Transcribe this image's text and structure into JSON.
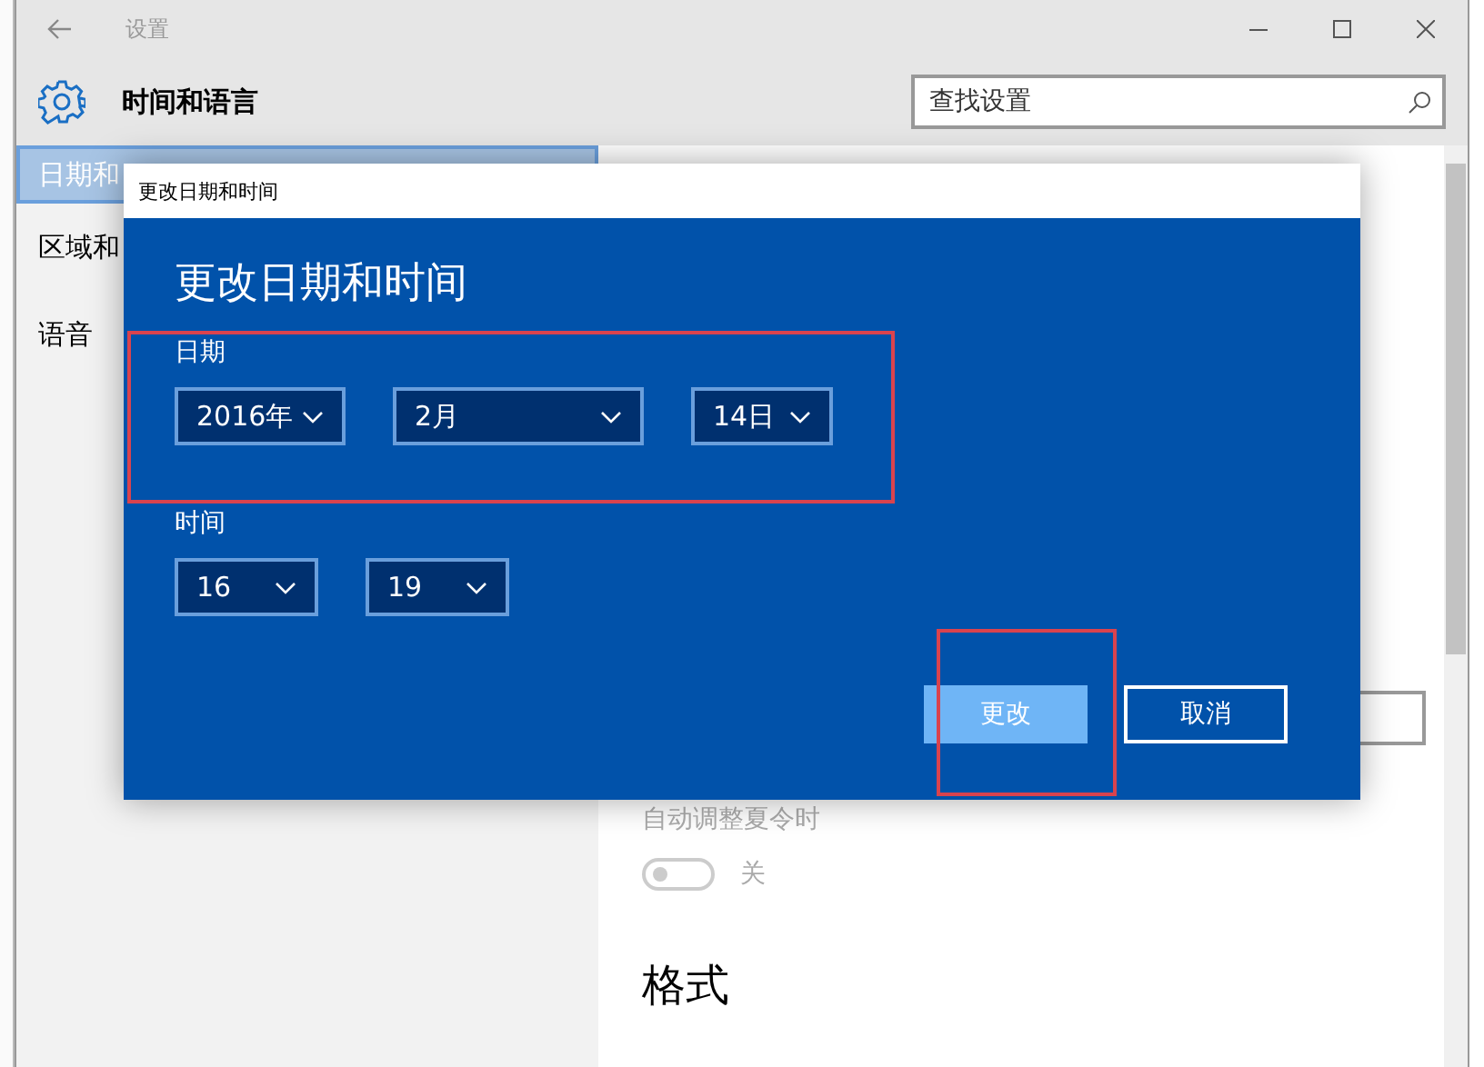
{
  "window": {
    "title": "设置"
  },
  "header": {
    "title": "时间和语言",
    "search": {
      "placeholder": "查找设置"
    }
  },
  "sidebar": {
    "items": [
      {
        "label": "日期和",
        "selected": true
      },
      {
        "label": "区域和",
        "selected": false
      },
      {
        "label": "语音",
        "selected": false
      }
    ]
  },
  "content": {
    "dst": {
      "label": "自动调整夏令时",
      "on": false,
      "disabled": true,
      "state_text": "关"
    },
    "section_title": "格式"
  },
  "dialog": {
    "title": "更改日期和时间",
    "heading": "更改日期和时间",
    "groups": [
      {
        "label": "日期",
        "highlighted": true,
        "selects": [
          "2016年",
          "2月",
          "14日"
        ]
      },
      {
        "label": "时间",
        "highlighted": false,
        "selects": [
          "16",
          "19"
        ]
      }
    ],
    "buttons": [
      {
        "label": "更改",
        "primary": true,
        "highlighted": true
      },
      {
        "label": "取消",
        "primary": false,
        "highlighted": false
      }
    ]
  }
}
